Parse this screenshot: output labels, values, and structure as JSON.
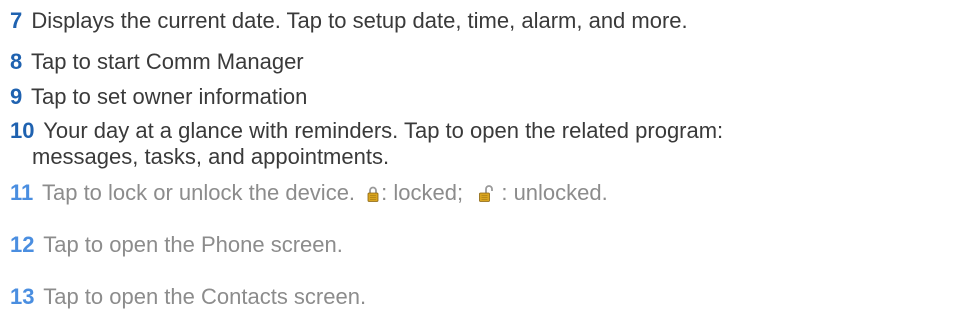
{
  "items": [
    {
      "num": "7",
      "text": "Displays the current date. Tap to setup date, time, alarm, and more."
    },
    {
      "num": "8",
      "text": "Tap to start Comm Manager"
    },
    {
      "num": "9",
      "text": "Tap to set owner information"
    },
    {
      "num": "10",
      "text": "Your day at a glance with reminders. Tap to open the related program:",
      "continuation": "messages, tasks, and appointments."
    },
    {
      "num": "11",
      "text_a": "Tap to lock or unlock the device.",
      "text_b": ": locked;",
      "text_c": " : unlocked.",
      "icons": [
        "locked-padlock-icon",
        "unlocked-padlock-icon"
      ]
    },
    {
      "num": "12",
      "text": "Tap to open the Phone screen."
    },
    {
      "num": "13",
      "text": "Tap to open the Contacts screen."
    }
  ],
  "colors": {
    "number_dark": "#1f62b0",
    "number_light": "#4a8ee0",
    "text_dark": "#3a3a3a",
    "text_light": "#8c8c8c",
    "lock_gold": "#d9a521"
  }
}
